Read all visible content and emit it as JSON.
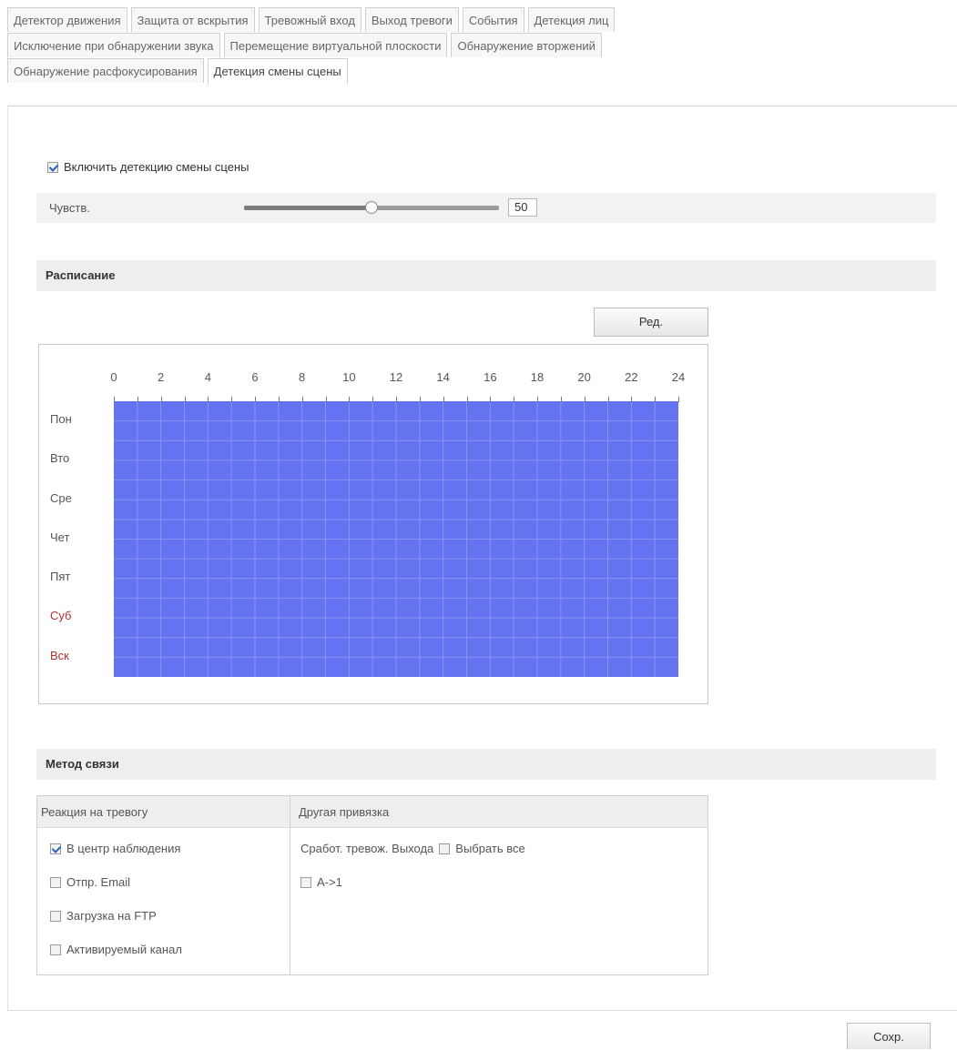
{
  "tabs": {
    "rows": [
      [
        "Детектор движения",
        "Защита от вскрытия",
        "Тревожный вход",
        "Выход тревоги",
        "События",
        "Детекция лиц"
      ],
      [
        "Исключение при обнаружении звука",
        "Перемещение виртуальной плоскости",
        "Обнаружение вторжений"
      ],
      [
        "Обнаружение расфокусирования",
        "Детекция смены сцены"
      ]
    ],
    "active": "Детекция смены сцены"
  },
  "enable": {
    "label": "Включить детекцию смены сцены",
    "checked": true
  },
  "sensitivity": {
    "label": "Чувств.",
    "value": "50",
    "level": 50
  },
  "schedule": {
    "title": "Расписание",
    "edit_label": "Ред.",
    "hours": [
      "0",
      "2",
      "4",
      "6",
      "8",
      "10",
      "12",
      "14",
      "16",
      "18",
      "20",
      "22",
      "24"
    ],
    "days": [
      "Пон",
      "Вто",
      "Сре",
      "Чет",
      "Пят",
      "Суб",
      "Вск"
    ],
    "weekend_color": "#b0322f",
    "fill_color": "#6473f0"
  },
  "linkage": {
    "title": "Метод связи",
    "alarm_header": "Реакция на тревогу",
    "other_header": "Другая привязка",
    "alarm_options": [
      {
        "label": "В центр наблюдения",
        "checked": true
      },
      {
        "label": "Отпр. Email",
        "checked": false
      },
      {
        "label": "Загрузка на FTP",
        "checked": false
      },
      {
        "label": "Активируемый канал",
        "checked": false
      }
    ],
    "trigger_label": "Сработ. тревож. Выхода",
    "select_all_label": "Выбрать все",
    "outputs": [
      {
        "label": "A->1",
        "checked": false
      }
    ]
  },
  "save_label": "Сохр."
}
